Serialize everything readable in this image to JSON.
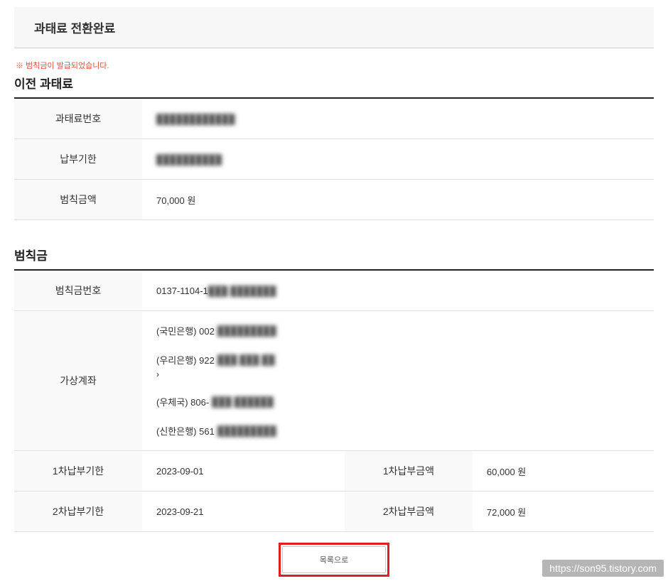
{
  "header": {
    "title": "과태료 전환완료"
  },
  "alert": "※ 범칙금이 발급되었습니다.",
  "prev_fine": {
    "title": "이전 과태료",
    "rows": {
      "number_label": "과태료번호",
      "number_value": "████████████",
      "due_label": "납부기한",
      "due_value": "██████████",
      "amount_label": "범칙금액",
      "amount_value": "70,000 원"
    }
  },
  "penalty": {
    "title": "범칙금",
    "rows": {
      "number_label": "범칙금번호",
      "number_prefix": "0137-1104-1",
      "number_masked": "███ ███████",
      "account_label": "가상계좌",
      "accounts": [
        {
          "bank": "(국민은행) 002",
          "masked": "█████████"
        },
        {
          "bank": "(우리은행) 922",
          "masked": "███ ███ ██",
          "has_chevron": true
        },
        {
          "bank": "(우체국) 806-",
          "masked": "███ ██████"
        },
        {
          "bank": "(신한은행) 561",
          "masked": "█████████"
        }
      ],
      "first_due_label": "1차납부기한",
      "first_due_value": "2023-09-01",
      "first_amount_label": "1차납부금액",
      "first_amount_value": "60,000 원",
      "second_due_label": "2차납부기한",
      "second_due_value": "2023-09-21",
      "second_amount_label": "2차납부금액",
      "second_amount_value": "72,000 원"
    }
  },
  "button": {
    "list_label": "목록으로"
  },
  "watermark": "https://son95.tistory.com"
}
